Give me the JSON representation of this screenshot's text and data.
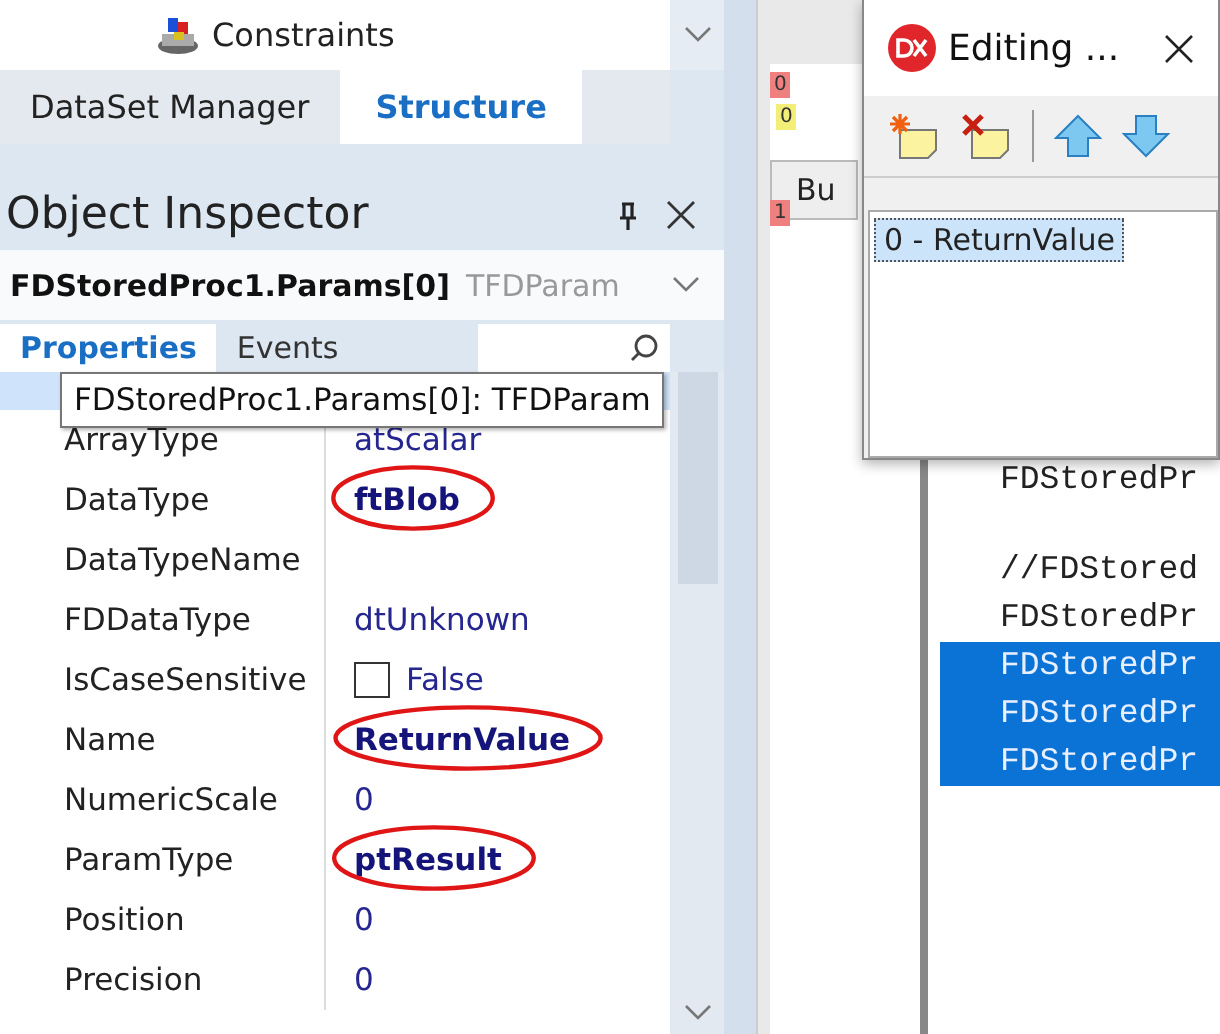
{
  "structure_tree": {
    "items": [
      {
        "label": "Constraints"
      }
    ]
  },
  "panel_tabs": [
    {
      "label": "DataSet Manager",
      "selected": false
    },
    {
      "label": "Structure",
      "selected": true
    }
  ],
  "inspector": {
    "title": "Object Inspector",
    "object": "FDStoredProc1.Params[0]",
    "object_type": "TFDParam",
    "tabs": [
      {
        "label": "Properties",
        "selected": true
      },
      {
        "label": "Events",
        "selected": false
      }
    ],
    "tooltip": "FDStoredProc1.Params[0]: TFDParam",
    "properties": [
      {
        "name": "ArrayType",
        "kind": "text",
        "value": "atScalar",
        "modified": false,
        "circled": false
      },
      {
        "name": "DataType",
        "kind": "text",
        "value": "ftBlob",
        "modified": true,
        "circled": true
      },
      {
        "name": "DataTypeName",
        "kind": "text"
      },
      {
        "name": "FDDataType",
        "kind": "text",
        "value": "dtUnknown",
        "modified": false,
        "circled": false
      },
      {
        "name": "IsCaseSensitive",
        "kind": "checkbox",
        "checked": false,
        "value": "False",
        "modified": false,
        "circled": false
      },
      {
        "name": "Name",
        "kind": "text",
        "value": "ReturnValue",
        "modified": true,
        "circled": true
      },
      {
        "name": "NumericScale",
        "kind": "text",
        "value": "0",
        "modified": false,
        "circled": false
      },
      {
        "name": "ParamType",
        "kind": "text",
        "value": "ptResult",
        "modified": true,
        "circled": true
      },
      {
        "name": "Position",
        "kind": "text",
        "value": "0",
        "modified": false,
        "circled": false
      },
      {
        "name": "Precision",
        "kind": "text",
        "value": "0",
        "modified": false,
        "circled": false
      }
    ]
  },
  "designer": {
    "button": "Bu",
    "markers": [
      {
        "label": "0",
        "color": "#ee8080"
      },
      {
        "label": "0",
        "color": "#f2ee78"
      },
      {
        "label": "1",
        "color": "#ee8080"
      }
    ]
  },
  "dialog": {
    "title": "Editing ...",
    "items": [
      {
        "label": "0 - ReturnValue",
        "selected": true
      }
    ]
  },
  "editor": {
    "lines": [
      {
        "kind": "code",
        "text": "FDStoredPr",
        "selected": false
      },
      {
        "kind": "blank"
      },
      {
        "kind": "code",
        "text": "//FDStored",
        "selected": false
      },
      {
        "kind": "code",
        "text": "FDStoredPr",
        "selected": false
      },
      {
        "kind": "code",
        "text": "FDStoredPr",
        "selected": true
      },
      {
        "kind": "code",
        "text": "FDStoredPr",
        "selected": true
      },
      {
        "kind": "code",
        "text": "FDStoredPr",
        "selected": true
      }
    ]
  }
}
